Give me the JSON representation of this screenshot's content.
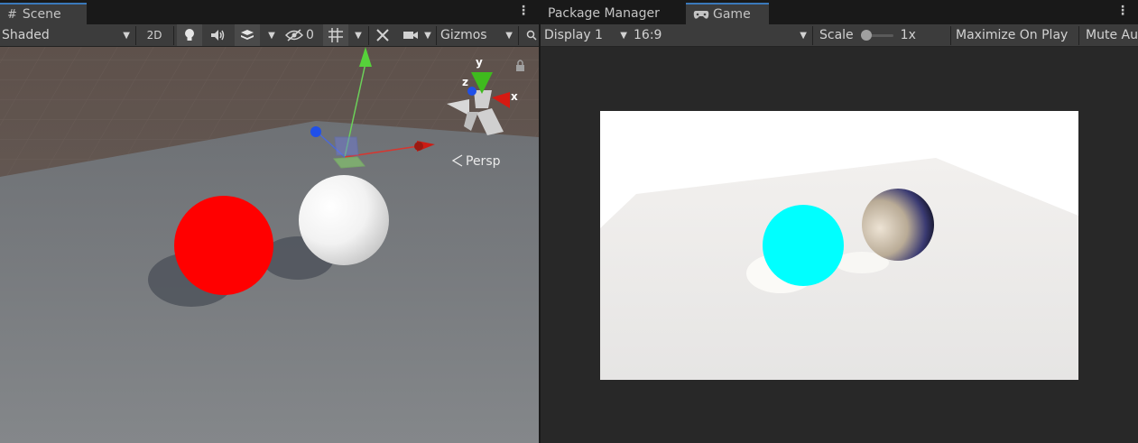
{
  "scene": {
    "tab_label": "Scene",
    "shading_mode": "Shaded",
    "mode_2d": "2D",
    "hidden_count": "0",
    "gizmos_label": "Gizmos",
    "view_label": "Persp",
    "axis_labels": {
      "x": "x",
      "y": "y",
      "z": "z"
    },
    "icons": [
      "grid-icon",
      "lightbulb-icon",
      "audio-icon",
      "effects-icon",
      "visibility-icon",
      "grid-snap-icon",
      "tools-icon",
      "camera-icon",
      "search-icon",
      "lock-icon"
    ],
    "colors": {
      "red_sphere": "#ff0000",
      "floor": "#7a7d80",
      "sky": "#5e514b"
    }
  },
  "game": {
    "tab_package_manager": "Package Manager",
    "tab_game": "Game",
    "display": "Display 1",
    "aspect": "16:9",
    "scale_label": "Scale",
    "scale_value": "1x",
    "maximize_on_play": "Maximize On Play",
    "mute_audio": "Mute Au",
    "icons": [
      "gamepad-icon"
    ],
    "colors": {
      "cyan_sphere": "#00ffff",
      "background": "#ffffff"
    }
  },
  "menu_glyph": "⋮"
}
